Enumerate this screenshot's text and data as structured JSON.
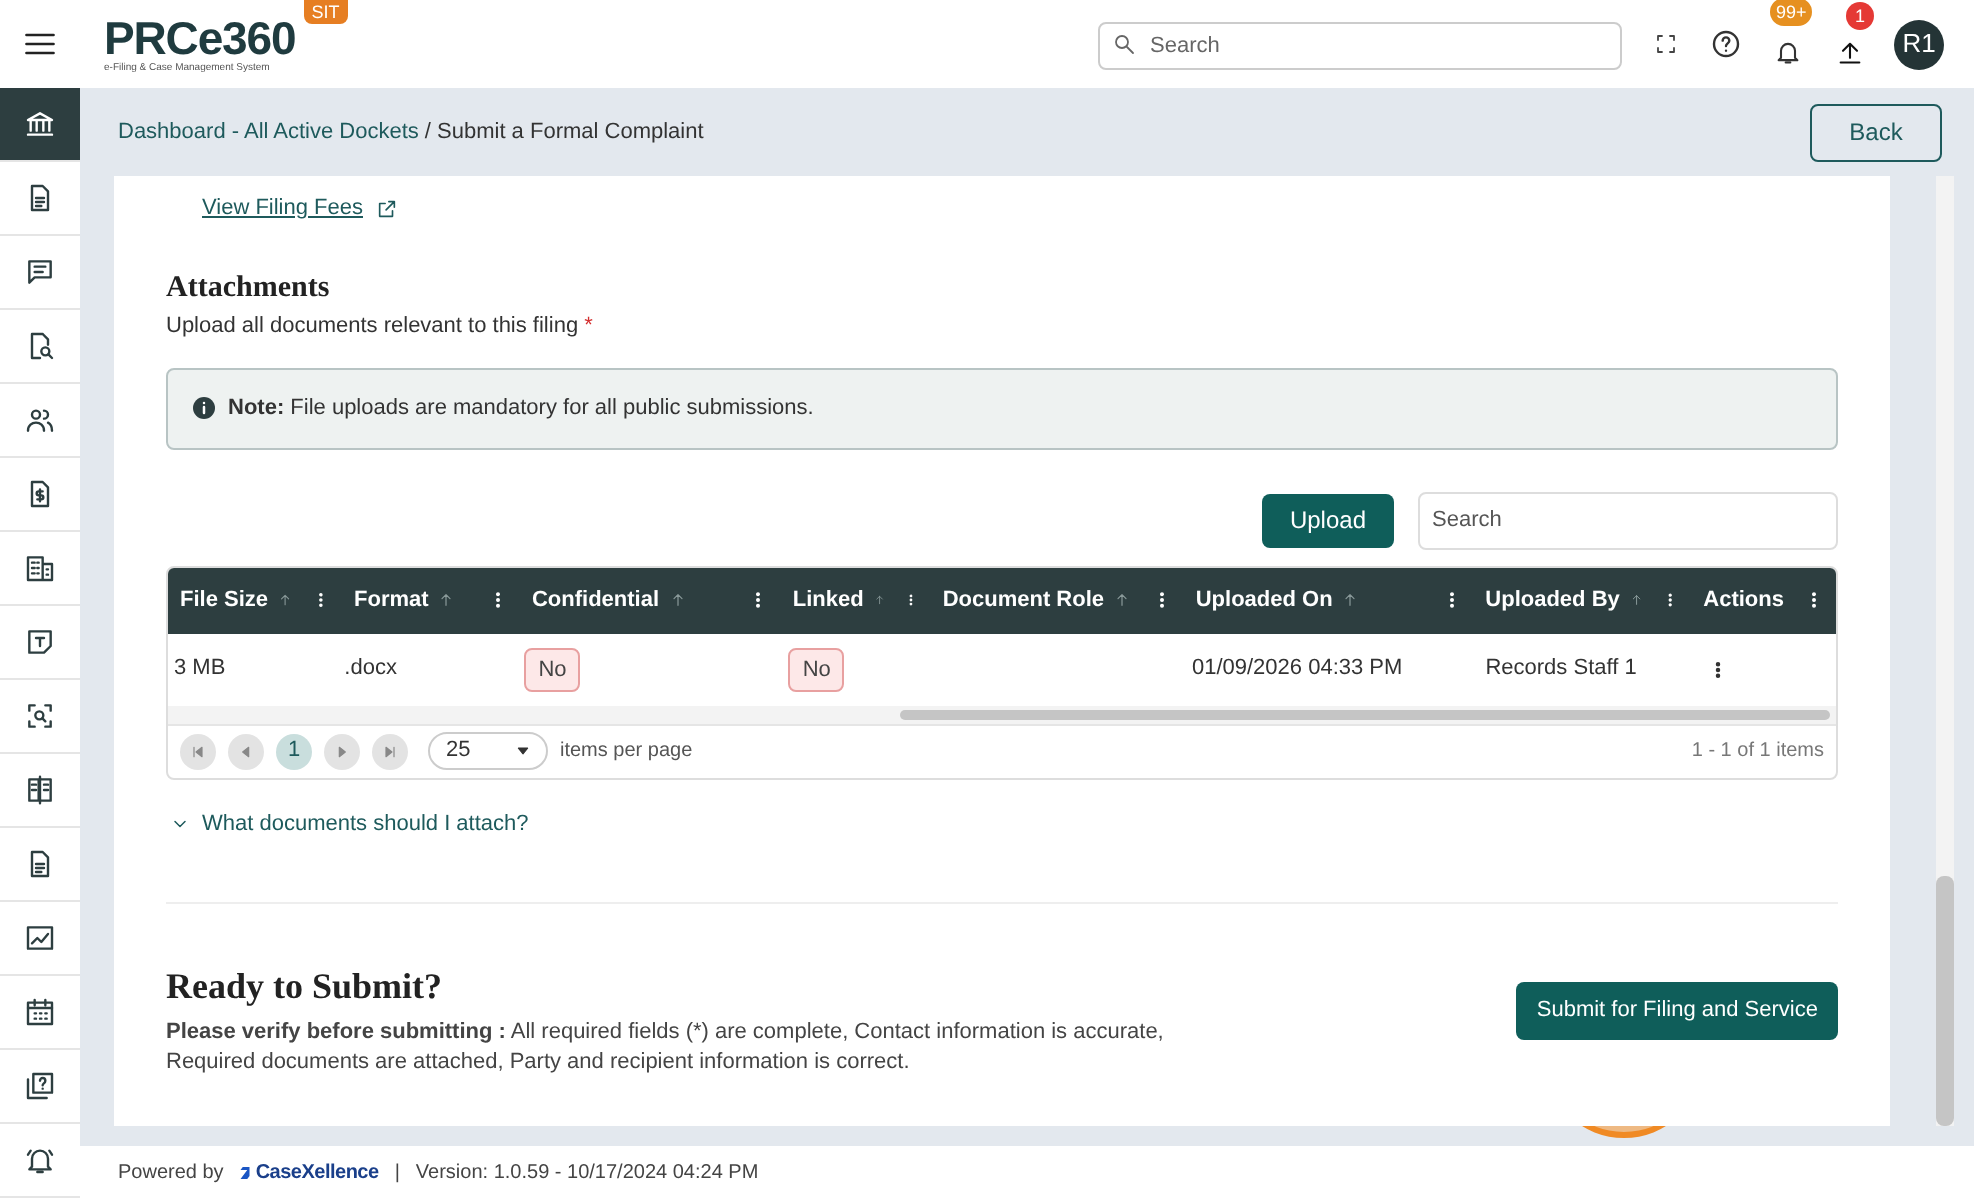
{
  "header": {
    "logo": "PRCe360",
    "logo_tagline": "e-Filing & Case Management System",
    "env_badge": "SIT",
    "search": {
      "placeholder": "Search"
    },
    "notifications_badge": "99+",
    "uploads_badge": "1",
    "avatar": "R1"
  },
  "sidebar": {
    "items": [
      {
        "selected": true
      },
      {
        "selected": false
      },
      {
        "selected": false
      },
      {
        "selected": false
      },
      {
        "selected": false
      },
      {
        "selected": false
      },
      {
        "selected": false
      },
      {
        "selected": false
      },
      {
        "selected": false
      },
      {
        "selected": false
      },
      {
        "selected": false
      },
      {
        "selected": false
      },
      {
        "selected": false
      },
      {
        "selected": false
      },
      {
        "selected": false
      }
    ]
  },
  "breadcrumb": {
    "link": "Dashboard - All Active Dockets",
    "current": "/ Submit a Formal Complaint"
  },
  "back_button": "Back",
  "fees_link": "View Filing Fees",
  "attachments": {
    "title": "Attachments",
    "subtitle": "Upload all documents relevant to this filing",
    "required_mark": "*",
    "note": "**Note:** File uploads are mandatory for all public submissions.",
    "upload_button": "Upload",
    "search": {
      "placeholder": "Search"
    }
  },
  "table": {
    "columns": [
      {
        "label": "File Size",
        "sortable": true
      },
      {
        "label": "Format",
        "sortable": true
      },
      {
        "label": "Confidential",
        "sortable": true
      },
      {
        "label": "Linked",
        "sortable": true
      },
      {
        "label": "Document Role",
        "sortable": true
      },
      {
        "label": "Uploaded On",
        "sortable": true
      },
      {
        "label": "Uploaded By",
        "sortable": true
      },
      {
        "label": "Actions",
        "sortable": false
      }
    ],
    "rows": [
      [
        {
          "kind": "text",
          "text": "3 MB"
        },
        {
          "kind": "text",
          "text": ".docx"
        },
        {
          "kind": "badge",
          "text": "No"
        },
        {
          "kind": "badge",
          "text": "No"
        },
        {
          "kind": "empty"
        },
        {
          "kind": "text",
          "text": "01/09/2026 04:33 PM"
        },
        {
          "kind": "text",
          "text": "Records Staff 1"
        },
        {
          "kind": "menu"
        }
      ]
    ]
  },
  "pager": {
    "pages": [
      {
        "label": "1",
        "selected": true
      }
    ],
    "page_size": "25",
    "page_size_label": "items per page",
    "summary": "1 - 1 of 1 items"
  },
  "faq": {
    "label": "What documents should I attach?",
    "expanded": false
  },
  "submit": {
    "title": "Ready to Submit?",
    "text": "**Please verify before submitting :** All required fields (*) are complete, Contact information is accurate, Required documents are attached, Party and recipient information is correct.",
    "button": "Submit for Filing and Service"
  },
  "footer": {
    "powered_by": "Powered by",
    "brand": "CaseXellence",
    "separator": "|",
    "version": "Version: 1.0.59 - 10/17/2024 04:24 PM"
  }
}
